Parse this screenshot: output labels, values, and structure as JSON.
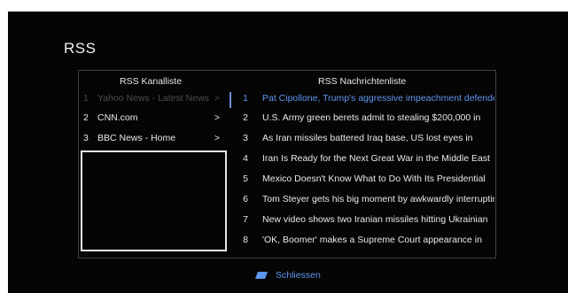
{
  "page": {
    "title": "RSS",
    "colors": {
      "background": "#050505",
      "text": "#e8e8e8",
      "accent": "#5e95ef",
      "dim": "#4a4c52"
    }
  },
  "channels": {
    "header": "RSS Kanalliste",
    "items": [
      {
        "num": "1",
        "name": "Yahoo News - Latest News",
        "arrow": ">",
        "state": "dim"
      },
      {
        "num": "2",
        "name": "CNN.com",
        "arrow": ">",
        "state": "normal"
      },
      {
        "num": "3",
        "name": "BBC News - Home",
        "arrow": ">",
        "state": "normal"
      }
    ]
  },
  "news": {
    "header": "RSS Nachrichtenliste",
    "items": [
      {
        "num": "1",
        "text": "Pat Cipollone, Trump's aggressive impeachment defender",
        "state": "active"
      },
      {
        "num": "2",
        "text": "U.S. Army green berets admit to stealing $200,000 in",
        "state": "normal"
      },
      {
        "num": "3",
        "text": "As Iran missiles battered Iraq base, US lost eyes in",
        "state": "normal"
      },
      {
        "num": "4",
        "text": "Iran Is Ready for the Next Great War in the Middle East",
        "state": "normal"
      },
      {
        "num": "5",
        "text": "Mexico Doesn't Know What to Do With Its Presidential",
        "state": "normal"
      },
      {
        "num": "6",
        "text": "Tom Steyer gets his big moment by awkwardly interrupting",
        "state": "normal"
      },
      {
        "num": "7",
        "text": "New video shows two Iranian missiles hitting Ukrainian",
        "state": "normal"
      },
      {
        "num": "8",
        "text": "'OK, Boomer' makes a Supreme Court appearance in",
        "state": "normal"
      }
    ]
  },
  "footer": {
    "close_label": "Schliessen",
    "close_icon": "blue-key-icon",
    "close_icon_color": "#5e95ef"
  }
}
